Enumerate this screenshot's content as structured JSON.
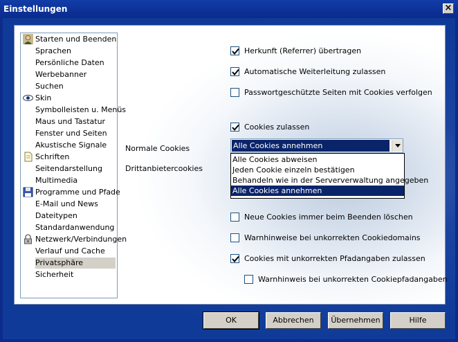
{
  "window": {
    "title": "Einstellungen",
    "close_glyph": "×"
  },
  "sidebar": {
    "items": [
      {
        "label": "Starten und Beenden",
        "icon": "person-icon"
      },
      {
        "label": "Sprachen"
      },
      {
        "label": "Persönliche Daten"
      },
      {
        "label": "Werbebanner"
      },
      {
        "label": "Suchen"
      },
      {
        "label": "Skin",
        "icon": "eye-icon"
      },
      {
        "label": "Symbolleisten u. Menüs"
      },
      {
        "label": "Maus und Tastatur"
      },
      {
        "label": "Fenster und Seiten"
      },
      {
        "label": "Akustische Signale"
      },
      {
        "label": "Schriften",
        "icon": "document-icon"
      },
      {
        "label": "Seitendarstellung"
      },
      {
        "label": "Multimedia"
      },
      {
        "label": "Programme und Pfade",
        "icon": "floppy-disk-icon"
      },
      {
        "label": "E-Mail und News"
      },
      {
        "label": "Dateitypen"
      },
      {
        "label": "Standardanwendung"
      },
      {
        "label": "Netzwerk/Verbindungen",
        "icon": "lock-icon"
      },
      {
        "label": "Verlauf und Cache"
      },
      {
        "label": "Privatsphäre",
        "selected": true
      },
      {
        "label": "Sicherheit"
      }
    ]
  },
  "options": {
    "referrer": {
      "label": "Herkunft (Referrer) übertragen",
      "checked": true
    },
    "redirect": {
      "label": "Automatische Weiterleitung zulassen",
      "checked": true
    },
    "password_cookies": {
      "label": "Passwortgeschützte Seiten mit Cookies verfolgen",
      "checked": false
    },
    "cookies_allowed": {
      "label": "Cookies zulassen",
      "checked": true
    },
    "delete_on_exit": {
      "label": "Neue Cookies immer beim Beenden löschen",
      "checked": false
    },
    "domain_warning": {
      "label": "Warnhinweise bei unkorrekten Cookiedomains",
      "checked": false
    },
    "path_allow": {
      "label": "Cookies mit unkorrekten Pfadangaben zulassen",
      "checked": true
    },
    "path_warning": {
      "label": "Warnhinweis bei unkorrekten Cookiepfadangaben",
      "checked": false
    }
  },
  "cookies": {
    "normal_label": "Normale Cookies",
    "thirdparty_label": "Drittanbietercookies",
    "normal_value": "Alle Cookies annehmen",
    "dropdown_options": [
      "Alle Cookies abweisen",
      "Jeden Cookie einzeln bestätigen",
      "Behandeln wie in der Serververwaltung angegeben",
      "Alle Cookies annehmen"
    ],
    "dropdown_selected_index": 3
  },
  "buttons": {
    "ok": "OK",
    "cancel": "Abbrechen",
    "apply": "Übernehmen",
    "help": "Hilfe"
  },
  "colors": {
    "selection": "#0a246a",
    "window_title": "#0a2a8c"
  }
}
